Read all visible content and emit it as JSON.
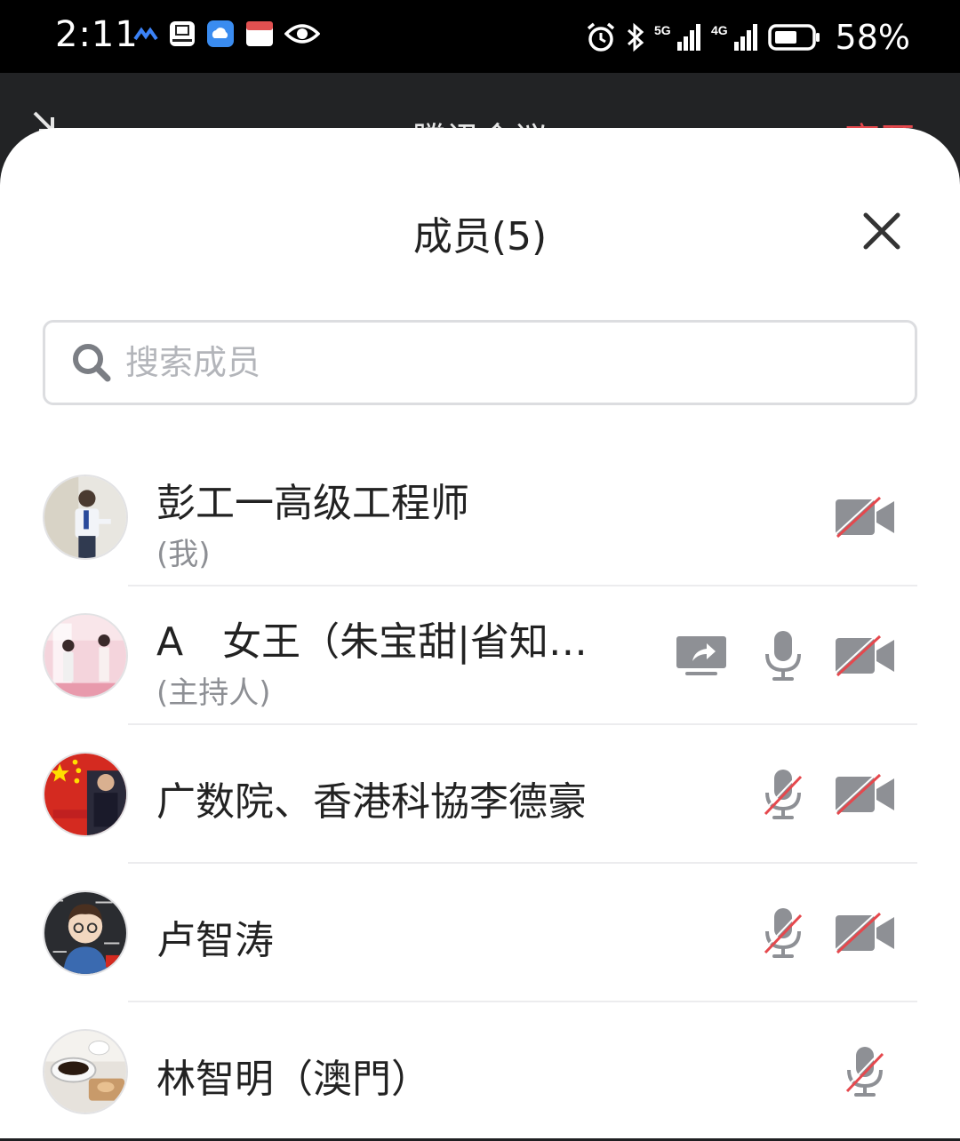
{
  "status_bar": {
    "time": "2:11",
    "battery": "58%",
    "left_icons": [
      "signal-app-icon",
      "huawei-icon",
      "cloud-icon",
      "app-icon",
      "eye-icon"
    ],
    "right_icons": [
      "alarm-icon",
      "bluetooth-icon",
      "5g-signal-icon",
      "4g-signal-icon",
      "battery-icon"
    ]
  },
  "header": {
    "title": "腾讯会议",
    "leave_label": "离开"
  },
  "panel": {
    "title": "成员(5)",
    "search_placeholder": "搜索成员"
  },
  "members": [
    {
      "name": "彭工一高级工程师",
      "role": "(我)",
      "sharing": false,
      "mic": "none",
      "video": "off"
    },
    {
      "name": "A　女王（朱宝甜|省知…",
      "role": "(主持人)",
      "sharing": true,
      "mic": "on",
      "video": "off"
    },
    {
      "name": "广数院、香港科協李德豪",
      "role": "",
      "sharing": false,
      "mic": "off",
      "video": "off"
    },
    {
      "name": "卢智涛",
      "role": "",
      "sharing": false,
      "mic": "off",
      "video": "off"
    },
    {
      "name": "林智明（澳門）",
      "role": "",
      "sharing": false,
      "mic": "off",
      "video": "none"
    }
  ],
  "colors": {
    "accent_red": "#e5484d",
    "icon_gray": "#8e9095",
    "text_primary": "#222222",
    "text_secondary": "#8d8f94"
  }
}
